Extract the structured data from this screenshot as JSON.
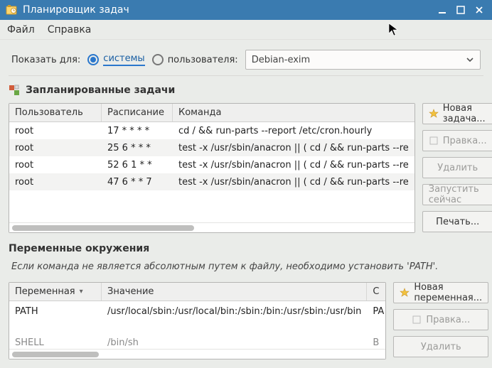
{
  "titlebar": {
    "title": "Планировщик задач"
  },
  "menu": {
    "file": "Файл",
    "help": "Справка"
  },
  "filter": {
    "label": "Показать для:",
    "system": "системы",
    "user_label": "пользователя:",
    "user_selected": "Debian-exim"
  },
  "tasks": {
    "title": "Запланированные задачи",
    "columns": {
      "user": "Пользователь",
      "schedule": "Расписание",
      "command": "Команда"
    },
    "rows": [
      {
        "user": "root",
        "schedule": "17 * * * *",
        "command": "cd / && run-parts --report /etc/cron.hourly"
      },
      {
        "user": "root",
        "schedule": "25 6 * * *",
        "command": "test -x /usr/sbin/anacron || ( cd / && run-parts --re"
      },
      {
        "user": "root",
        "schedule": "52 6 1 * *",
        "command": "test -x /usr/sbin/anacron || ( cd / && run-parts --re"
      },
      {
        "user": "root",
        "schedule": "47 6 * * 7",
        "command": "test -x /usr/sbin/anacron || ( cd / && run-parts --re"
      }
    ],
    "buttons": {
      "new": "Новая задача...",
      "edit": "Правка...",
      "delete": "Удалить",
      "run": "Запустить сейчас",
      "print": "Печать..."
    }
  },
  "vars": {
    "title": "Переменные окружения",
    "hint": "Если команда не является абсолютным путем к файлу, необходимо установить 'PATH'.",
    "columns": {
      "name": "Переменная",
      "value": "Значение",
      "c3": "С"
    },
    "rows": [
      {
        "name": "PATH",
        "value": "/usr/local/sbin:/usr/local/bin:/sbin:/bin:/usr/sbin:/usr/bin",
        "c3": "PA"
      },
      {
        "name": "SHELL",
        "value": "/bin/sh",
        "c3": "B"
      }
    ],
    "buttons": {
      "new": "Новая переменная...",
      "edit": "Правка...",
      "delete": "Удалить"
    }
  }
}
